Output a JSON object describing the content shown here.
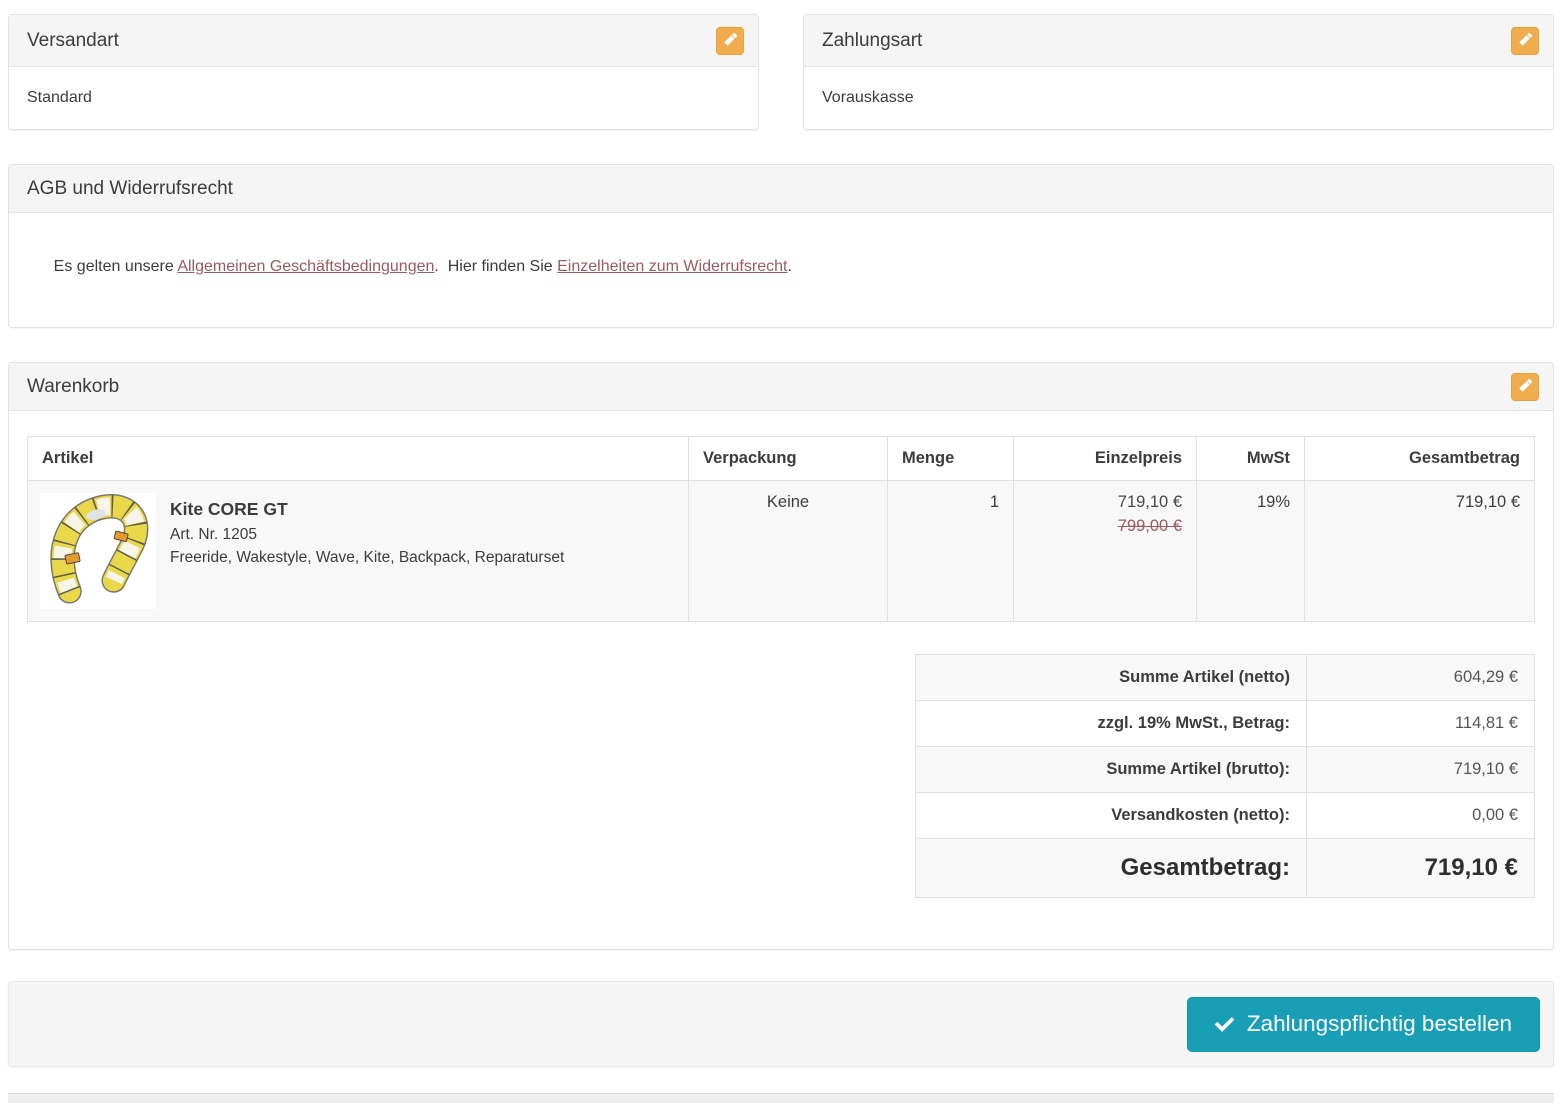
{
  "colors": {
    "edit_button": "#f0ad4e",
    "order_button": "#189fb5",
    "link": "#a0585f",
    "panel_header_bg": "#f5f5f5",
    "stripe_bg": "#f8f8f8"
  },
  "shipping": {
    "title": "Versandart",
    "value": "Standard"
  },
  "payment": {
    "title": "Zahlungsart",
    "value": "Vorauskasse"
  },
  "terms": {
    "title": "AGB und Widerrufsrecht",
    "text_before": "Es gelten unsere ",
    "link_terms": "Allgemeinen Geschäftsbedingungen",
    "text_middle": ".  Hier finden Sie ",
    "link_withdrawal": "Einzelheiten zum Widerrufsrecht",
    "text_after": "."
  },
  "cart": {
    "title": "Warenkorb",
    "headers": {
      "article": "Artikel",
      "packaging": "Verpackung",
      "quantity": "Menge",
      "unit_price": "Einzelpreis",
      "vat": "MwSt",
      "total": "Gesamtbetrag"
    },
    "rows": [
      {
        "name": "Kite CORE GT",
        "art_nr": "Art. Nr. 1205",
        "features": "Freeride, Wakestyle, Wave, Kite, Backpack, Reparaturset",
        "image_alt": "kite-product-photo",
        "packaging": "Keine",
        "quantity": "1",
        "unit_price": "719,10 €",
        "old_price": "799,00 €",
        "vat": "19%",
        "total": "719,10 €"
      }
    ],
    "summary": [
      {
        "label": "Summe Artikel (netto)",
        "value": "604,29 €"
      },
      {
        "label": "zzgl. 19% MwSt., Betrag:",
        "value": "114,81 €"
      },
      {
        "label": "Summe Artikel (brutto):",
        "value": "719,10 €"
      },
      {
        "label": "Versandkosten (netto):",
        "value": "0,00 €"
      },
      {
        "label": "Gesamtbetrag:",
        "value": "719,10 €"
      }
    ]
  },
  "order_button": {
    "label": "Zahlungspflichtig bestellen"
  }
}
